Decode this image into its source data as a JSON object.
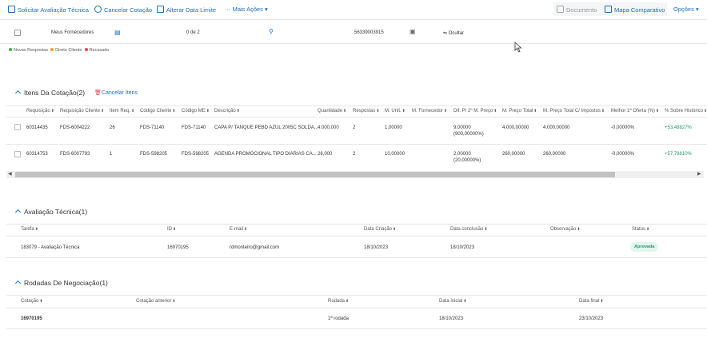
{
  "toolbar": {
    "solicitar": "Solicitar Avaliação Técnica",
    "cancelar_cotacao": "Cancelar Cotação",
    "alterar_data": "Alterar Data Limite",
    "mais_acoes": "Mais Ações",
    "documento": "Documento",
    "mapa": "Mapa Comparativo",
    "opcoes": "Opções"
  },
  "supplier_row": {
    "label": "Meus Fornecedores",
    "count": "0 de 2",
    "number": "56339003915",
    "hide": "Ocultar"
  },
  "legend": {
    "novas": "Novas Respostas",
    "direto": "Direto Cliente",
    "recusado": "Recusado",
    "colors": {
      "novas": "#3bb24b",
      "direto": "#f0a020",
      "recusado": "#e04848"
    }
  },
  "items": {
    "title": "Itens Da Cotação(2)",
    "cancel": "Cancelar Itens",
    "headers": [
      "Requisição",
      "Requisição Cliente",
      "Item Req.",
      "Código Cliente",
      "Código ME",
      "Descrição",
      "Quantidade",
      "Respostas",
      "M. Unit.",
      "M. Fornecedor",
      "Dif. P/ 2º M. Preço",
      "M. Preço Total",
      "M. Preço Total C/ Impostos",
      "Melhor 1ª Oferta (%)",
      "% Sobre Histórico"
    ],
    "rows": [
      {
        "req": "60314435",
        "req_cliente": "FDS-6004222",
        "item": "26",
        "cod_cliente": "FDS-71140",
        "cod_me": "FDS-71140",
        "desc": "CAPA P/ TANQUE PEBD AZUL 2005C SOLDA...",
        "qtd": "4.000,000",
        "resp": "2",
        "unit": "1,00000",
        "fornecedor": "",
        "dif1": "9,00000",
        "dif2": "(900,00000%)",
        "total": "4.000,00000",
        "total_imp": "4.000,00000",
        "melhor": "-0,00000%",
        "hist": "+53,48827%"
      },
      {
        "req": "60314753",
        "req_cliente": "FDS-6007793",
        "item": "1",
        "cod_cliente": "FDS-598205",
        "cod_me": "FDS-598205",
        "desc": "AGENDA PROMOCIONAL TIPO DIARIAS CA...",
        "qtd": "26,000",
        "resp": "2",
        "unit": "10,00000",
        "fornecedor": "",
        "dif1": "2,00000",
        "dif2": "(20,00000%)",
        "total": "260,00000",
        "total_imp": "260,00000",
        "melhor": "-0,00000%",
        "hist": "+57,78810%"
      }
    ]
  },
  "avaliacao": {
    "title": "Avaliação Técnica(1)",
    "headers": [
      "Tarefa",
      "ID",
      "E-mail",
      "Data Criação",
      "Data conclusão",
      "Observação",
      "Status"
    ],
    "row": {
      "tarefa": "183079 - Avaliação Técnica",
      "id": "16970195",
      "email": "rdmonteiro@gmail.com",
      "criacao": "18/10/2023",
      "conclusao": "18/10/2023",
      "obs": "",
      "status": "Aprovada"
    }
  },
  "rodadas": {
    "title": "Rodadas De Negociação(1)",
    "headers": [
      "Cotação",
      "Cotação anterior",
      "Rodada",
      "Data inicial",
      "Data final"
    ],
    "row": {
      "cotacao": "16970195",
      "anterior": "",
      "rodada": "1ª rodada",
      "inicial": "18/10/2023",
      "final": "23/10/2023"
    }
  }
}
